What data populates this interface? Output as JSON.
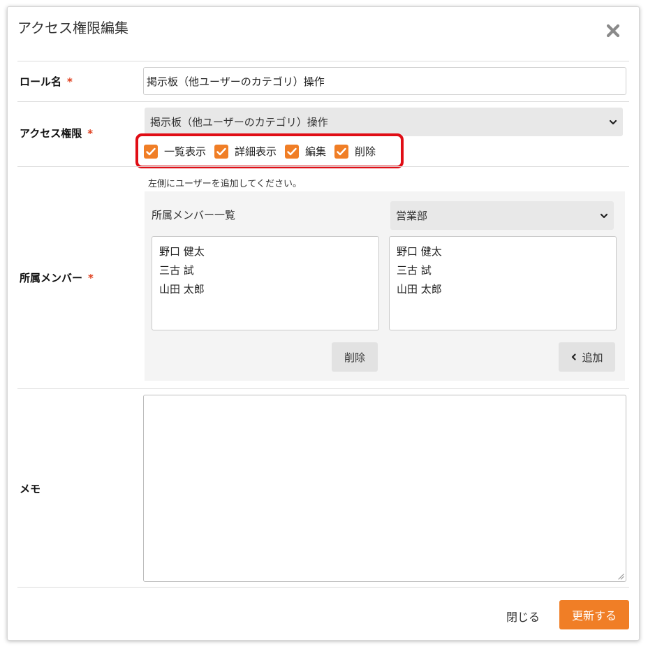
{
  "dialog": {
    "title": "アクセス権限編集"
  },
  "role_name": {
    "label": "ロール名",
    "required_mark": "*",
    "value": "掲示板（他ユーザーのカテゴリ）操作"
  },
  "access": {
    "label": "アクセス権限",
    "required_mark": "*",
    "selected": "掲示板（他ユーザーのカテゴリ）操作",
    "permissions": [
      {
        "label": "一覧表示",
        "checked": true
      },
      {
        "label": "詳細表示",
        "checked": true
      },
      {
        "label": "編集",
        "checked": true
      },
      {
        "label": "削除",
        "checked": true
      }
    ]
  },
  "members": {
    "label": "所属メンバー",
    "required_mark": "*",
    "hint": "左側にユーザーを追加してください。",
    "panel_title": "所属メンバー一覧",
    "department": "営業部",
    "assigned": [
      "野口 健太",
      "三古 試",
      "山田 太郎"
    ],
    "available": [
      "野口 健太",
      "三古 試",
      "山田 太郎"
    ],
    "remove_label": "削除",
    "add_label": "追加"
  },
  "memo": {
    "label": "メモ",
    "value": ""
  },
  "footer": {
    "close_label": "閉じる",
    "update_label": "更新する"
  },
  "colors": {
    "accent": "#f07e26",
    "highlight": "#e00d15",
    "required": "#e0401f"
  }
}
